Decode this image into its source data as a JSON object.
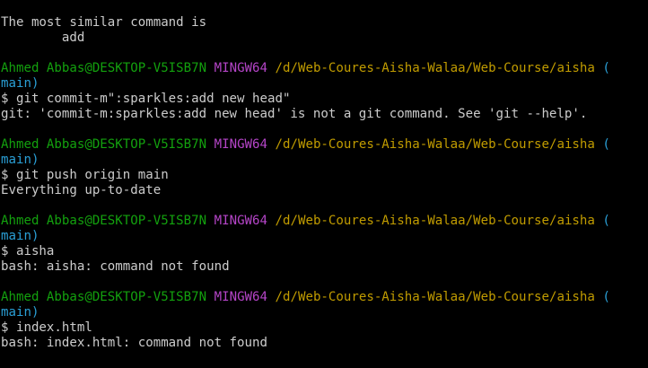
{
  "colors": {
    "background": "#000000",
    "text": "#cccccc",
    "user_host": "#13a10e",
    "system": "#b545c8",
    "path": "#c19c00",
    "branch": "#2a9fd6"
  },
  "intro": {
    "line1": "The most similar command is",
    "line2": "        add"
  },
  "blocks": [
    {
      "user_host": "Ahmed Abbas@DESKTOP-V5ISB7N",
      "system": "MINGW64",
      "path": "/d/Web-Coures-Aisha-Walaa/Web-Course/aisha",
      "branch_open": "(",
      "branch": "main)",
      "command": "$ git commit-m\":sparkles:add new head\"",
      "output": "git: 'commit-m:sparkles:add new head' is not a git command. See 'git --help'."
    },
    {
      "user_host": "Ahmed Abbas@DESKTOP-V5ISB7N",
      "system": "MINGW64",
      "path": "/d/Web-Coures-Aisha-Walaa/Web-Course/aisha",
      "branch_open": "(",
      "branch": "main)",
      "command": "$ git push origin main",
      "output": "Everything up-to-date"
    },
    {
      "user_host": "Ahmed Abbas@DESKTOP-V5ISB7N",
      "system": "MINGW64",
      "path": "/d/Web-Coures-Aisha-Walaa/Web-Course/aisha",
      "branch_open": "(",
      "branch": "main)",
      "command": "$ aisha",
      "output": "bash: aisha: command not found"
    },
    {
      "user_host": "Ahmed Abbas@DESKTOP-V5ISB7N",
      "system": "MINGW64",
      "path": "/d/Web-Coures-Aisha-Walaa/Web-Course/aisha",
      "branch_open": "(",
      "branch": "main)",
      "command": "$ index.html",
      "output": "bash: index.html: command not found"
    }
  ]
}
